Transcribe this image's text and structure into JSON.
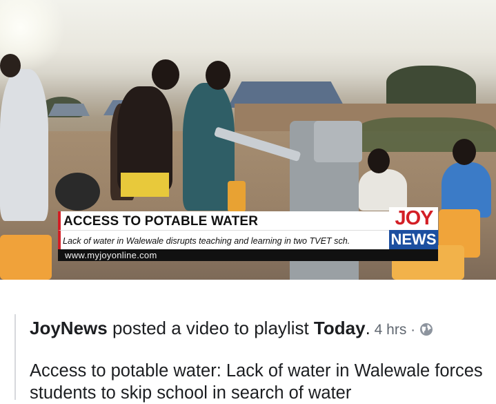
{
  "video": {
    "overlay_title": "ACCESS TO POTABLE WATER",
    "overlay_subtitle": "Lack of water in Walewale disrupts teaching and learning in two TVET sch.",
    "overlay_url": "www.myjoyonline.com",
    "logo_top": "JOY",
    "logo_bottom": "NEWS",
    "colors": {
      "logo_red": "#d31f26",
      "logo_blue": "#1c4fa0",
      "url_bar": "#111111"
    }
  },
  "post": {
    "author": "JoyNews",
    "action": " posted a video to playlist ",
    "playlist": "Today",
    "period": ".",
    "time": " 4 hrs · ",
    "privacy_icon": "globe-icon",
    "text": "Access to potable water: Lack of water in Walewale forces students to skip school in search of water"
  }
}
